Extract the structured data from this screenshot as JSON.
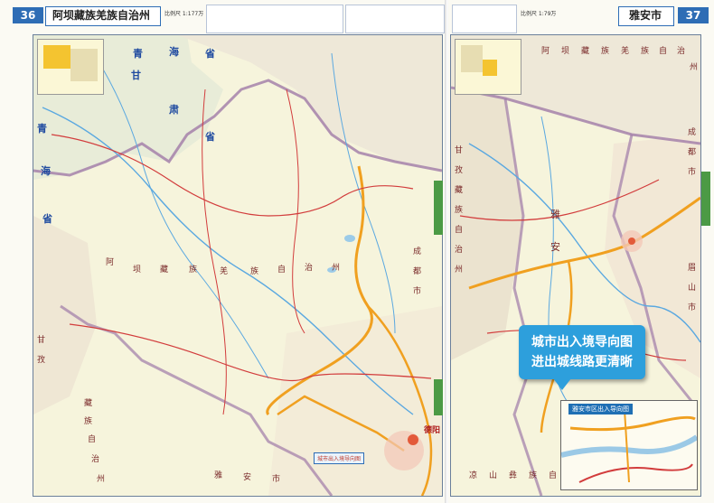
{
  "left_page": {
    "page_number": "36",
    "title": "阿坝藏族羌族自治州",
    "scale": "比例尺 1:177万",
    "province_labels": [
      "青",
      "海",
      "省",
      "甘",
      "肃",
      "省",
      "青",
      "海",
      "省"
    ],
    "region_label": [
      "阿",
      "坝",
      "藏",
      "族",
      "羌",
      "族",
      "自",
      "治",
      "州"
    ],
    "bottom_label": [
      "雅",
      "安",
      "市"
    ],
    "side_labels": [
      "甘",
      "孜",
      "藏",
      "族",
      "自",
      "治",
      "州"
    ],
    "right_label": [
      "成",
      "都",
      "市"
    ],
    "city_label": "德阳",
    "callout_box": "城市出入境导向图"
  },
  "right_page": {
    "page_number": "37",
    "title": "雅安市",
    "scale": "比例尺 1:79万",
    "labels_top": [
      "阿",
      "坝",
      "藏",
      "族",
      "羌",
      "族",
      "自",
      "治",
      "州"
    ],
    "labels_left": [
      "甘",
      "孜",
      "藏",
      "族",
      "自",
      "治",
      "州"
    ],
    "labels_right": [
      "成",
      "都",
      "市",
      "眉",
      "山",
      "市"
    ],
    "region_label": [
      "雅",
      "安"
    ],
    "bottom_label": [
      "凉",
      "山",
      "彝",
      "族",
      "自",
      "治",
      "州"
    ],
    "callout": {
      "line1": "城市出入境导向图",
      "line2": "进出城线路更清晰"
    },
    "inset_title": "雅安市区出入导向图"
  },
  "colors": {
    "page_blue": "#2e6db5",
    "callout_blue": "#2d9fdc",
    "border_purple": "#a07aa8",
    "highway_orange": "#f0a020",
    "road_red": "#d23c3c",
    "river_blue": "#5aa8e0",
    "land_yellow": "#f6f4dc",
    "tab_green": "#4c9a45"
  }
}
